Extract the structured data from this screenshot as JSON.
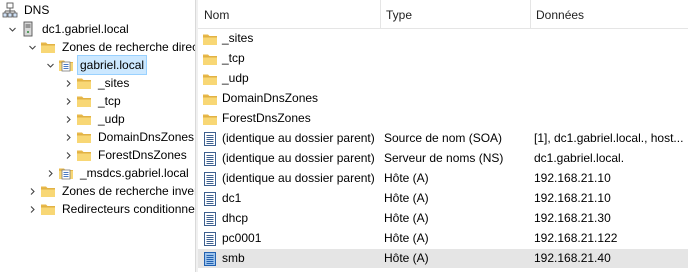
{
  "tree": {
    "root": "DNS",
    "server": "dc1.gabriel.local",
    "forward_zones": "Zones de recherche directe",
    "zone": "gabriel.local",
    "subfolders": [
      "_sites",
      "_tcp",
      "_udp",
      "DomainDnsZones",
      "ForestDnsZones"
    ],
    "msdcs": "_msdcs.gabriel.local",
    "reverse_zones": "Zones de recherche inversée",
    "forwarders": "Redirecteurs conditionnels"
  },
  "list": {
    "columns": {
      "name": "Nom",
      "type": "Type",
      "data": "Données"
    },
    "rows": [
      {
        "name": "_sites",
        "type": "",
        "data": "",
        "icon": "folder-icon"
      },
      {
        "name": "_tcp",
        "type": "",
        "data": "",
        "icon": "folder-icon"
      },
      {
        "name": "_udp",
        "type": "",
        "data": "",
        "icon": "folder-icon"
      },
      {
        "name": "DomainDnsZones",
        "type": "",
        "data": "",
        "icon": "folder-icon"
      },
      {
        "name": "ForestDnsZones",
        "type": "",
        "data": "",
        "icon": "folder-icon"
      },
      {
        "name": "(identique au dossier parent)",
        "type": "Source de nom (SOA)",
        "data": "[1], dc1.gabriel.local., host...",
        "icon": "record-icon"
      },
      {
        "name": "(identique au dossier parent)",
        "type": "Serveur de noms (NS)",
        "data": "dc1.gabriel.local.",
        "icon": "record-icon"
      },
      {
        "name": "(identique au dossier parent)",
        "type": "Hôte (A)",
        "data": "192.168.21.10",
        "icon": "record-icon"
      },
      {
        "name": "dc1",
        "type": "Hôte (A)",
        "data": "192.168.21.10",
        "icon": "record-icon"
      },
      {
        "name": "dhcp",
        "type": "Hôte (A)",
        "data": "192.168.21.30",
        "icon": "record-icon"
      },
      {
        "name": "pc0001",
        "type": "Hôte (A)",
        "data": "192.168.21.122",
        "icon": "record-icon"
      },
      {
        "name": "smb",
        "type": "Hôte (A)",
        "data": "192.168.21.40",
        "icon": "record-icon-selected"
      }
    ]
  }
}
